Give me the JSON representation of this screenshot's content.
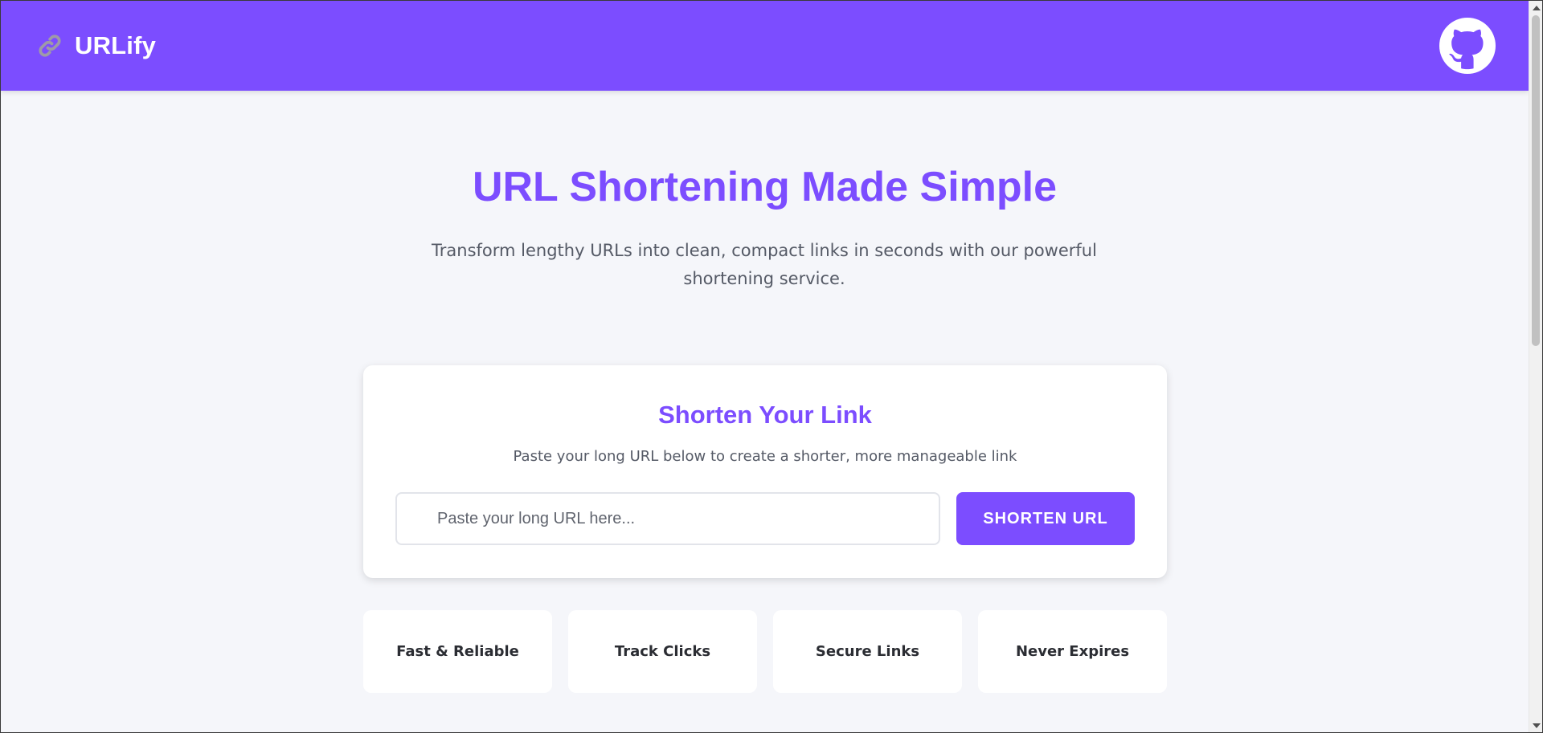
{
  "header": {
    "brand_icon": "link-icon",
    "brand_name": "URLify",
    "github_icon": "github-icon"
  },
  "hero": {
    "title": "URL Shortening Made Simple",
    "subtitle": "Transform lengthy URLs into clean, compact links in seconds with our powerful shortening service."
  },
  "shortener": {
    "title": "Shorten Your Link",
    "description": "Paste your long URL below to create a shorter, more manageable link",
    "input_value": "",
    "input_placeholder": "Paste your long URL here...",
    "button_label": "SHORTEN URL"
  },
  "features": [
    {
      "label": "Fast & Reliable"
    },
    {
      "label": "Track Clicks"
    },
    {
      "label": "Secure Links"
    },
    {
      "label": "Never Expires"
    }
  ],
  "colors": {
    "accent": "#7c4dff",
    "background": "#f5f6fa",
    "card": "#ffffff"
  }
}
